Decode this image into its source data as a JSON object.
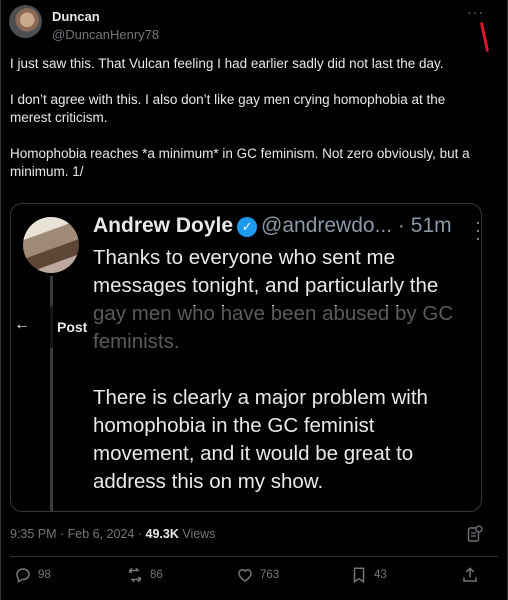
{
  "post": {
    "author_name": "Duncan",
    "author_handle": "@DuncanHenry78",
    "more_glyph": "···",
    "paragraphs": [
      "I just saw this. That Vulcan feeling I had earlier sadly did not last the day.",
      "I don’t agree with this. I also don’t like gay men crying homophobia at the merest criticism.",
      "Homophobia reaches *a minimum* in GC feminism. Not zero obviously, but a minimum. 1/"
    ],
    "timestamp": "9:35 PM · Feb 6, 2024 · ",
    "views_count": "49.3K",
    "views_label": " Views"
  },
  "quoted": {
    "name": "Andrew Doyle",
    "handle": "@andrewdo...",
    "separator": " · ",
    "time": "51m",
    "paragraphs": [
      "Thanks to everyone who sent me messages tonight, and particularly the gay men who have been abused by GC feminists.",
      "There is clearly a major problem with homophobia in the GC feminist movement, and it would be great to address this on my show."
    ],
    "overlay_title": "Post",
    "verified_color": "#1d9bf0"
  },
  "actions": {
    "replies": "98",
    "reposts": "86",
    "likes": "763",
    "bookmarks": "43"
  },
  "icons": [
    "more-icon",
    "verified-icon",
    "back-arrow-icon",
    "analytics-icon",
    "reply-icon",
    "repost-icon",
    "like-icon",
    "bookmark-icon",
    "share-icon"
  ]
}
